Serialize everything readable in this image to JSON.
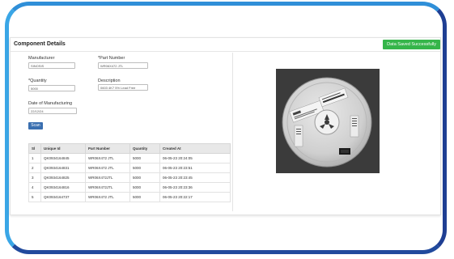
{
  "panel": {
    "title": "Component Details",
    "saved_badge": "Data Saved Successfully"
  },
  "form": {
    "manufacturer_label": "Manufacturer",
    "manufacturer_value": "SINOSIS",
    "part_number_label": "*Part Number",
    "part_number_value": "WR06X472 JTL",
    "quantity_label": "*Quantity",
    "quantity_value": "5000",
    "description_label": "Description",
    "description_value": "0603 4K7 5% Lead Free",
    "date_label": "Date of Manufacturing",
    "date_value": "22/12/24",
    "scan_button": "Scan"
  },
  "table": {
    "headers": [
      "Sl",
      "Unique Id",
      "Part Number",
      "Quantity",
      "Created At"
    ],
    "rows": [
      [
        "1",
        "QK0934164845",
        "WR06X472 JTL",
        "5000",
        "06-05-23 20:24:05"
      ],
      [
        "2",
        "QK0934164831",
        "WR06X472 JTL",
        "5000",
        "06-05-23 20:23:51"
      ],
      [
        "3",
        "QK0934164825",
        "WR06X472JTL",
        "5000",
        "06-05-23 20:23:45"
      ],
      [
        "4",
        "QK0934164816",
        "WR06X472JTL",
        "5000",
        "06-05-23 20:23:36"
      ],
      [
        "5",
        "QK0934164737",
        "WR06X472 JTL",
        "5000",
        "06-05-23 20:22:17"
      ]
    ]
  },
  "colors": {
    "success": "#35b54a",
    "accent": "#3a6fb0",
    "frame_blue": "#2f8fd8",
    "frame_navy": "#1f3f93"
  }
}
